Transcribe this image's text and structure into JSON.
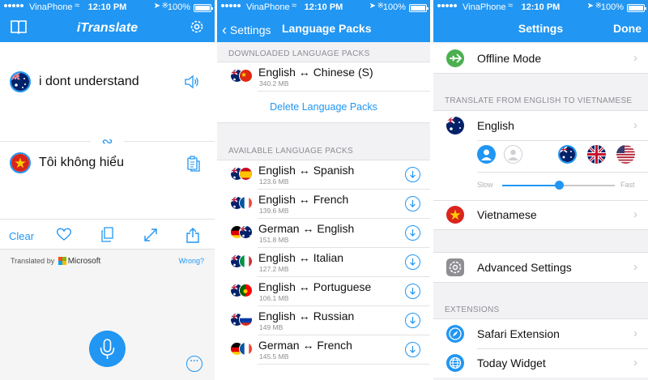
{
  "status_bar": {
    "carrier": "VinaPhone",
    "time": "12:10 PM",
    "battery": "100%"
  },
  "translator": {
    "app_title": "iTranslate",
    "source_text": "i dont understand",
    "target_text": "Tôi không hiểu",
    "clear_label": "Clear",
    "translated_by": "Translated by",
    "provider": "Microsoft",
    "wrong_label": "Wrong?"
  },
  "language_packs": {
    "back_label": "Settings",
    "title": "Language Packs",
    "downloaded_header": "DOWNLOADED LANGUAGE PACKS",
    "downloaded": [
      {
        "name": "English ↔ Chinese (S)",
        "size": "340.2 MB"
      }
    ],
    "delete_label": "Delete Language Packs",
    "available_header": "AVAILABLE LANGUAGE PACKS",
    "available": [
      {
        "name": "English ↔ Spanish",
        "size": "123.6 MB"
      },
      {
        "name": "English ↔ French",
        "size": "139.6 MB"
      },
      {
        "name": "German ↔ English",
        "size": "151.8 MB"
      },
      {
        "name": "English ↔ Italian",
        "size": "127.2 MB"
      },
      {
        "name": "English ↔ Portuguese",
        "size": "106.1 MB"
      },
      {
        "name": "English ↔ Russian",
        "size": "149 MB"
      },
      {
        "name": "German ↔ French",
        "size": "145.5 MB"
      }
    ]
  },
  "settings": {
    "title": "Settings",
    "done_label": "Done",
    "offline_mode": "Offline Mode",
    "translate_header": "TRANSLATE FROM ENGLISH TO VIETNAMESE",
    "source_language": "English",
    "target_language": "Vietnamese",
    "slow_label": "Slow",
    "fast_label": "Fast",
    "speech_speed": 0.5,
    "advanced_settings": "Advanced Settings",
    "extensions_header": "EXTENSIONS",
    "safari_extension": "Safari Extension",
    "today_widget": "Today Widget"
  },
  "colors": {
    "accent": "#2196f3",
    "offline_green": "#4caf50",
    "vietnam_red": "#da251d"
  }
}
